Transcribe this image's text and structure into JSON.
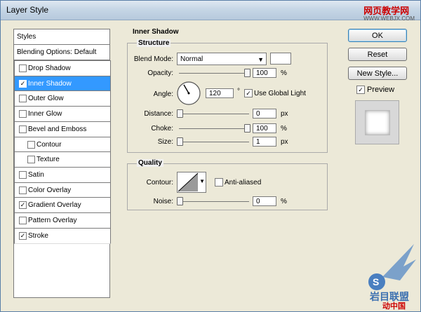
{
  "window": {
    "title": "Layer Style"
  },
  "watermark": {
    "site": "网页教学网",
    "url": "WWW.WEBJX.COM",
    "footer": "动中国"
  },
  "styles": {
    "header": "Styles",
    "blending": "Blending Options: Default",
    "items": [
      {
        "label": "Drop Shadow",
        "checked": false,
        "selected": false,
        "sub": false
      },
      {
        "label": "Inner Shadow",
        "checked": true,
        "selected": true,
        "sub": false
      },
      {
        "label": "Outer Glow",
        "checked": false,
        "selected": false,
        "sub": false
      },
      {
        "label": "Inner Glow",
        "checked": false,
        "selected": false,
        "sub": false
      },
      {
        "label": "Bevel and Emboss",
        "checked": false,
        "selected": false,
        "sub": false
      },
      {
        "label": "Contour",
        "checked": false,
        "selected": false,
        "sub": true
      },
      {
        "label": "Texture",
        "checked": false,
        "selected": false,
        "sub": true
      },
      {
        "label": "Satin",
        "checked": false,
        "selected": false,
        "sub": false
      },
      {
        "label": "Color Overlay",
        "checked": false,
        "selected": false,
        "sub": false
      },
      {
        "label": "Gradient Overlay",
        "checked": true,
        "selected": false,
        "sub": false
      },
      {
        "label": "Pattern Overlay",
        "checked": false,
        "selected": false,
        "sub": false
      },
      {
        "label": "Stroke",
        "checked": true,
        "selected": false,
        "sub": false
      }
    ]
  },
  "inner_shadow": {
    "title": "Inner Shadow",
    "structure_title": "Structure",
    "blend_mode_label": "Blend Mode:",
    "blend_mode_value": "Normal",
    "shadow_color": "#ffffff",
    "opacity_label": "Opacity:",
    "opacity_value": "100",
    "opacity_unit": "%",
    "opacity_level": 1.0,
    "angle_label": "Angle:",
    "angle_value": "120",
    "angle_unit": "°",
    "global_light_label": "Use Global Light",
    "global_light_checked": true,
    "distance_label": "Distance:",
    "distance_value": "0",
    "distance_unit": "px",
    "distance_level": 0.0,
    "choke_label": "Choke:",
    "choke_value": "100",
    "choke_unit": "%",
    "choke_level": 1.0,
    "size_label": "Size:",
    "size_value": "1",
    "size_unit": "px",
    "size_level": 0.0
  },
  "quality": {
    "title": "Quality",
    "contour_label": "Contour:",
    "anti_aliased_label": "Anti-aliased",
    "anti_aliased_checked": false,
    "noise_label": "Noise:",
    "noise_value": "0",
    "noise_unit": "%",
    "noise_level": 0.0
  },
  "buttons": {
    "ok": "OK",
    "reset": "Reset",
    "new_style": "New Style...",
    "preview_label": "Preview",
    "preview_checked": true
  },
  "colors": {
    "selection": "#3399ff",
    "title_bar": "#c6d6e6"
  }
}
